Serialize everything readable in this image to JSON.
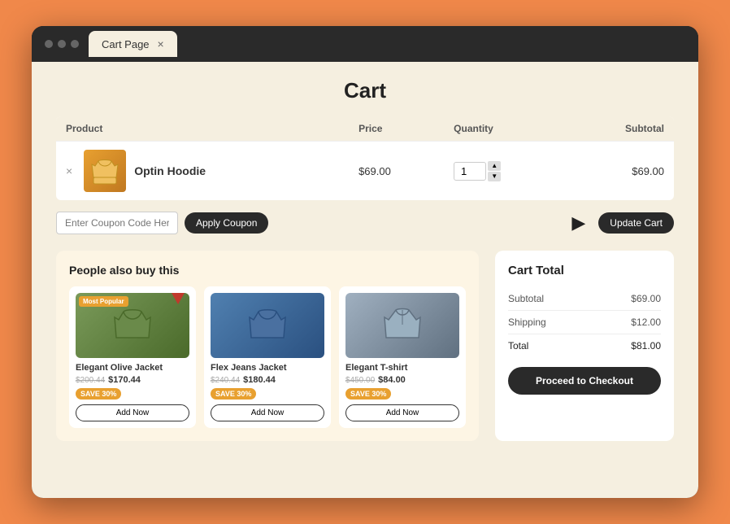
{
  "browser": {
    "tab_label": "Cart Page",
    "tab_close": "×"
  },
  "page": {
    "title": "Cart"
  },
  "cart_table": {
    "headers": [
      "Product",
      "Price",
      "Quantity",
      "Subtotal"
    ],
    "row": {
      "product_name": "Optin Hoodie",
      "price": "$69.00",
      "quantity": "1",
      "subtotal": "$69.00"
    }
  },
  "cart_actions": {
    "coupon_placeholder": "Enter Coupon Code Here...",
    "apply_label": "Apply Coupon",
    "update_label": "Update Cart"
  },
  "people_also_buy": {
    "title": "People also buy this",
    "products": [
      {
        "name": "Elegant Olive Jacket",
        "old_price": "$200.44",
        "new_price": "$170.44",
        "save_badge": "SAVE 30%",
        "add_label": "Add Now",
        "badge": "Most Popular"
      },
      {
        "name": "Flex Jeans Jacket",
        "old_price": "$240.44",
        "new_price": "$180.44",
        "save_badge": "SAVE 30%",
        "add_label": "Add Now",
        "badge": ""
      },
      {
        "name": "Elegant T-shirt",
        "old_price": "$450.00",
        "new_price": "$84.00",
        "save_badge": "SAVE 30%",
        "add_label": "Add Now",
        "badge": ""
      }
    ]
  },
  "cart_total": {
    "title": "Cart Total",
    "subtotal_label": "Subtotal",
    "subtotal_value": "$69.00",
    "shipping_label": "Shipping",
    "shipping_value": "$12.00",
    "total_label": "Total",
    "total_value": "$81.00",
    "checkout_label": "Proceed to Checkout"
  }
}
